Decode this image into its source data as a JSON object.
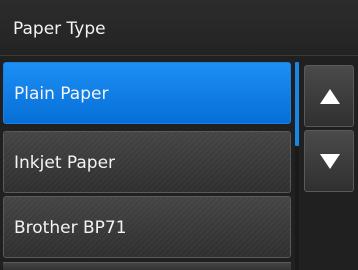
{
  "header": {
    "title": "Paper Type"
  },
  "list": {
    "items": [
      {
        "label": "Plain Paper",
        "selected": true
      },
      {
        "label": "Inkjet Paper",
        "selected": false
      },
      {
        "label": "Brother BP71",
        "selected": false
      }
    ]
  },
  "nav": {
    "up_icon": "triangle-up-icon",
    "down_icon": "triangle-down-icon"
  },
  "colors": {
    "selected": "#0a78e6",
    "background": "#202020"
  }
}
